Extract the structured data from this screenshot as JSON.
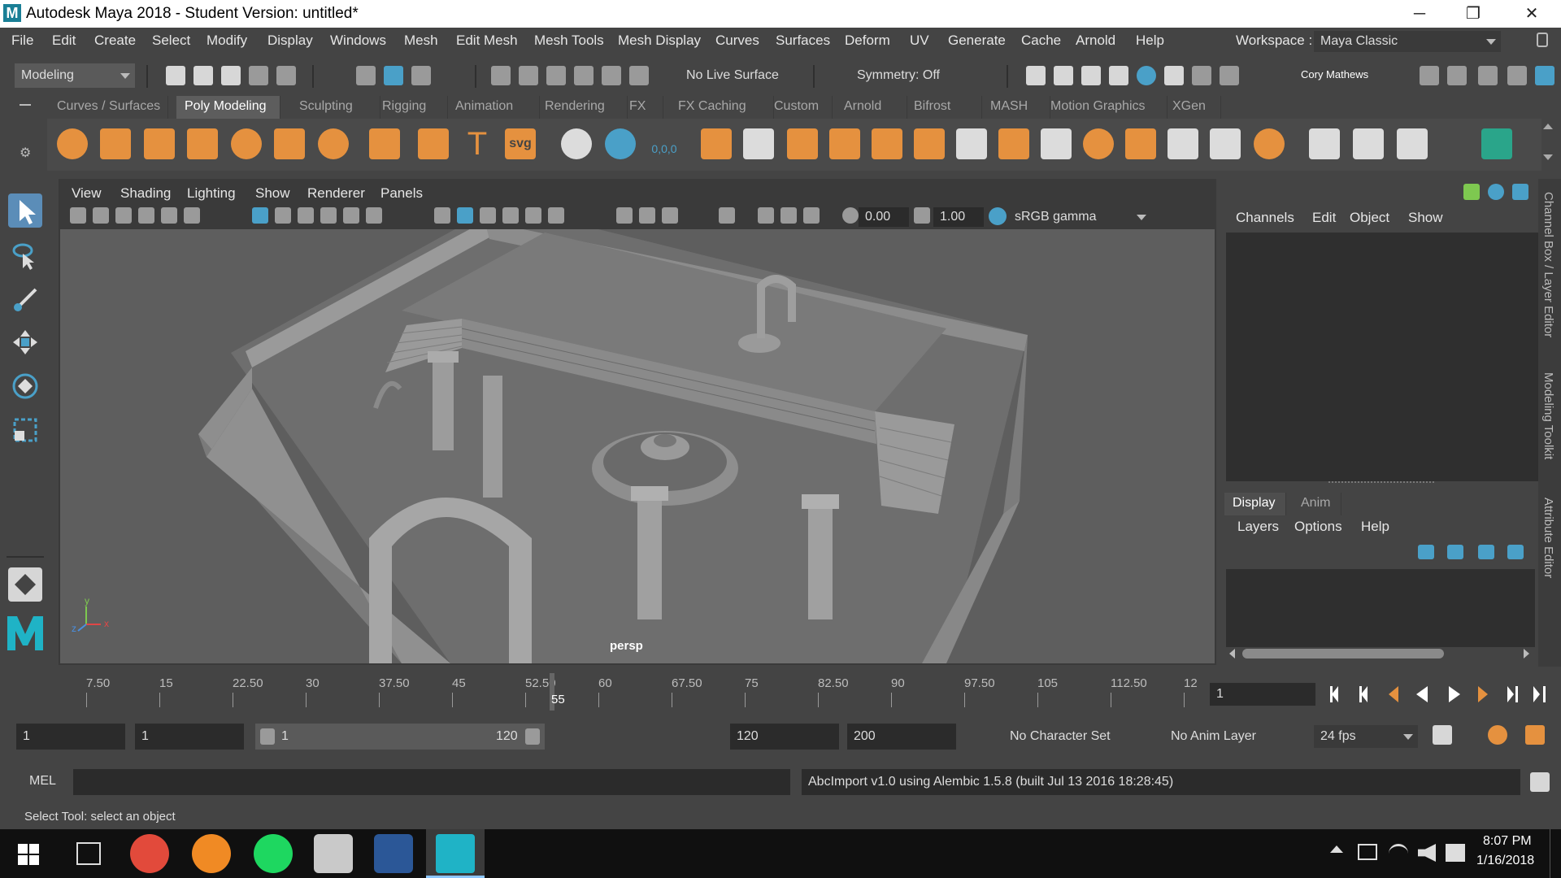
{
  "window": {
    "app_letter": "M",
    "title": "Autodesk Maya 2018 - Student Version: untitled*",
    "minimize": "─",
    "maximize": "❐",
    "close": "✕"
  },
  "menubar": {
    "items": [
      "File",
      "Edit",
      "Create",
      "Select",
      "Modify",
      "Display",
      "Windows",
      "Mesh",
      "Edit Mesh",
      "Mesh Tools",
      "Mesh Display",
      "Curves",
      "Surfaces",
      "Deform",
      "UV",
      "Generate",
      "Cache",
      "Arnold",
      "Help"
    ],
    "workspace_label": "Workspace :",
    "workspace_value": "Maya Classic"
  },
  "statusline": {
    "menuset": "Modeling",
    "live_surface": "No Live Surface",
    "symmetry": "Symmetry: Off",
    "user": "Cory Mathews"
  },
  "shelf": {
    "tabs": [
      "Curves / Surfaces",
      "Poly Modeling",
      "Sculpting",
      "Rigging",
      "Animation",
      "Rendering",
      "FX",
      "FX Caching",
      "Custom",
      "Arnold",
      "Bifrost",
      "MASH",
      "Motion Graphics",
      "XGen"
    ],
    "active_tab": "Poly Modeling",
    "text_tool": "T",
    "svg_tool": "svg",
    "snow_label": "0,0,0"
  },
  "viewport": {
    "menus": [
      "View",
      "Shading",
      "Lighting",
      "Show",
      "Renderer",
      "Panels"
    ],
    "exposure": "0.00",
    "gamma": "1.00",
    "color_space": "sRGB gamma",
    "camera": "persp",
    "axis_x": "x",
    "axis_y": "y",
    "axis_z": "z"
  },
  "channelbox": {
    "menus": [
      "Channels",
      "Edit",
      "Object",
      "Show"
    ],
    "layer_tabs": [
      "Display",
      "Anim"
    ],
    "layer_menus": [
      "Layers",
      "Options",
      "Help"
    ],
    "side_tabs": [
      "Channel Box / Layer Editor",
      "Modeling Toolkit",
      "Attribute Editor"
    ]
  },
  "timeslider": {
    "ticks": [
      "7.50",
      "15",
      "22.50",
      "30",
      "37.50",
      "45",
      "52.50",
      "60",
      "67.50",
      "75",
      "82.50",
      "90",
      "97.50",
      "105",
      "112.50",
      "12"
    ],
    "current_frame": "55",
    "current_frame_field": "1"
  },
  "range": {
    "start": "1",
    "playback_start": "1",
    "slider_start": "1",
    "slider_end": "120",
    "playback_end": "120",
    "end": "200",
    "character_set": "No Character Set",
    "anim_layer": "No Anim Layer",
    "fps": "24 fps"
  },
  "cmdline": {
    "language": "MEL",
    "result": "AbcImport v1.0 using Alembic 1.5.8 (built Jul 13 2016 18:28:45)"
  },
  "helpline": {
    "text": "Select Tool: select an object"
  },
  "taskbar": {
    "time": "8:07 PM",
    "date": "1/16/2018"
  }
}
